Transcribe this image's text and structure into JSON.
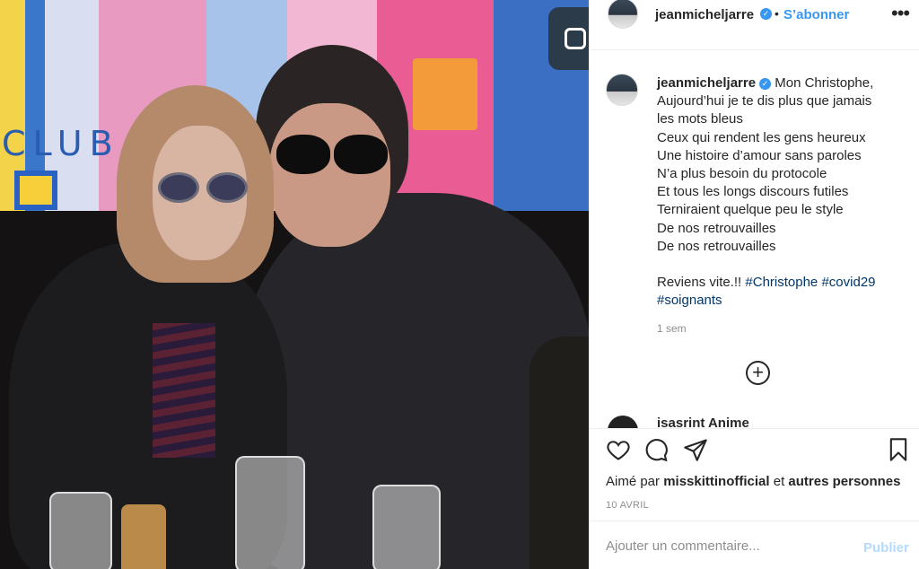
{
  "post": {
    "username": "jeanmicheljarre",
    "follow_label": "S’abonner",
    "separator": "•",
    "more_label": "•••"
  },
  "caption": {
    "username": "jeanmicheljarre",
    "lines": [
      "Mon Christophe,",
      "Aujourd’hui je te dis plus que jamais",
      "les mots bleus",
      "Ceux qui rendent les gens heureux",
      "Une histoire d’amour sans paroles",
      "N’a plus besoin du protocole",
      "Et tous les longs discours futiles",
      "Terniraient quelque peu le style",
      "De nos retrouvailles",
      "De nos retrouvailles"
    ],
    "closing": "Reviens vite.!!",
    "hashtags": [
      "#Christophe",
      "#covid29",
      "#soignants"
    ],
    "time": "1 sem"
  },
  "load_more_label": "+",
  "next_comment": {
    "username": "isasrint Anime"
  },
  "likes": {
    "prefix": "Aimé par",
    "user": "misskittinofficial",
    "connector": "et",
    "others": "autres personnes"
  },
  "date": "10 AVRIL",
  "comment": {
    "placeholder": "Ajouter un commentaire...",
    "publish_label": "Publier"
  },
  "photo": {
    "wall_text": "CLUB"
  },
  "icons": {
    "verified": "verified-badge-icon",
    "like": "heart-icon",
    "comment": "comment-bubble-icon",
    "share": "paper-plane-icon",
    "save": "bookmark-icon",
    "more": "more-options-icon",
    "load_more": "plus-circle-icon",
    "photo_overlay": "photo-carousel-icon"
  },
  "colors": {
    "accent": "#3897f0",
    "hashtag": "#00376b",
    "muted": "#8e8e8e",
    "publish_disabled": "#b3dbff"
  }
}
